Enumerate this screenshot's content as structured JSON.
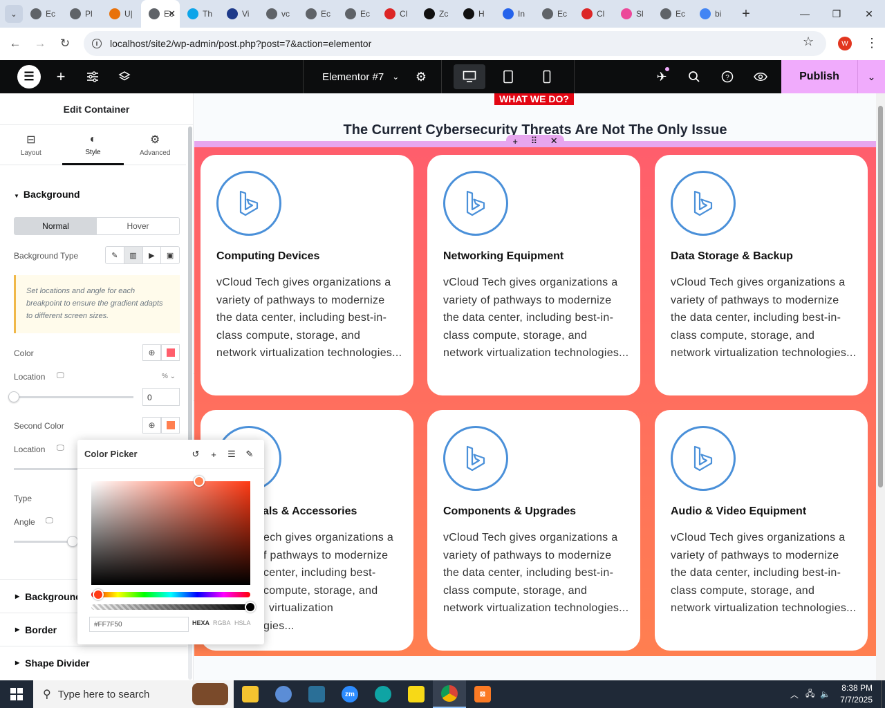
{
  "browser": {
    "tabs": [
      {
        "title": "Ec",
        "color": "#5f6368"
      },
      {
        "title": "Pl",
        "color": "#5f6368"
      },
      {
        "title": "U|",
        "color": "#e8710a"
      },
      {
        "title": "Ec",
        "color": "#5f6368",
        "active": true
      },
      {
        "title": "Th",
        "color": "#0ea5e9"
      },
      {
        "title": "Vi",
        "color": "#1e3a8a"
      },
      {
        "title": "vc",
        "color": "#5f6368"
      },
      {
        "title": "Ec",
        "color": "#5f6368"
      },
      {
        "title": "Ec",
        "color": "#5f6368"
      },
      {
        "title": "Cl",
        "color": "#dc2626"
      },
      {
        "title": "Zc",
        "color": "#111111"
      },
      {
        "title": "H",
        "color": "#111111"
      },
      {
        "title": "In",
        "color": "#2563eb"
      },
      {
        "title": "Ec",
        "color": "#5f6368"
      },
      {
        "title": "Cl",
        "color": "#dc2626"
      },
      {
        "title": "Sl",
        "color": "#ec4899"
      },
      {
        "title": "Ec",
        "color": "#5f6368"
      },
      {
        "title": "bi",
        "color": "#4285f4"
      }
    ],
    "url": "localhost/site2/wp-admin/post.php?post=7&action=elementor",
    "profile_initial": "W"
  },
  "editor": {
    "document_title": "Elementor #7",
    "publish_label": "Publish"
  },
  "panel": {
    "title": "Edit Container",
    "tabs": {
      "layout": "Layout",
      "style": "Style",
      "advanced": "Advanced"
    },
    "background_section": "Background",
    "state_normal": "Normal",
    "state_hover": "Hover",
    "background_type_label": "Background Type",
    "notice": "Set locations and angle for each breakpoint to ensure the gradient adapts to different screen sizes.",
    "color_label": "Color",
    "location_label": "Location",
    "location_unit": "% ⌄",
    "location_value": "0",
    "second_color_label": "Second Color",
    "second_location_label": "Location",
    "type_label": "Type",
    "angle_label": "Angle",
    "color_swatch": "#ff5e6c",
    "second_swatch": "#ff7f50",
    "collapsed": [
      "Background",
      "Border",
      "Shape Divider"
    ]
  },
  "color_picker": {
    "title": "Color Picker",
    "hex_value": "#FF7F50",
    "formats": [
      "HEXA",
      "RGBA",
      "HSLA"
    ]
  },
  "canvas": {
    "badge": "WHAT WE DO?",
    "heading": "The Current Cybersecurity Threats Are Not The Only Issue",
    "card_text": "vCloud Tech gives organizations a variety of pathways to modernize the data center, including best-in-class compute, storage, and network virtualization technologies...",
    "cards": [
      {
        "title": "Computing Devices"
      },
      {
        "title": "Networking Equipment"
      },
      {
        "title": "Data Storage & Backup"
      },
      {
        "title": "als & Accessories"
      },
      {
        "title": "Components & Upgrades"
      },
      {
        "title": "Audio & Video Equipment"
      }
    ],
    "card_text_partial": [
      "ech gives organizations a",
      "f pathways to modernize",
      "center, including best-",
      "compute, storage, and",
      "virtualization",
      "gies..."
    ]
  },
  "taskbar": {
    "search_placeholder": "Type here to search",
    "time": "8:38 PM",
    "date": "7/7/2025"
  }
}
